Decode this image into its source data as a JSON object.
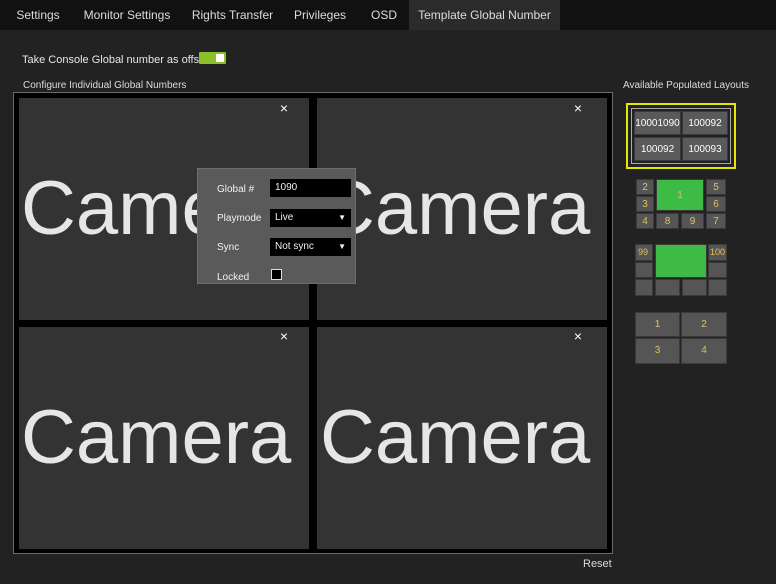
{
  "tabs": [
    {
      "label": "Settings",
      "active": false
    },
    {
      "label": "Monitor Settings",
      "active": false
    },
    {
      "label": "Rights Transfer",
      "active": false
    },
    {
      "label": "Privileges",
      "active": false
    },
    {
      "label": "OSD",
      "active": false
    },
    {
      "label": "Template Global Number",
      "active": true
    }
  ],
  "offset": {
    "label": "Take Console Global number as offset",
    "enabled": true
  },
  "configure_label": "Configure Individual Global Numbers",
  "available_label": "Available Populated Layouts",
  "panes": [
    {
      "text": "Camera",
      "close": "×"
    },
    {
      "text": "Camera",
      "close": "×"
    },
    {
      "text": "Camera",
      "close": "×"
    },
    {
      "text": "Camera",
      "close": "×"
    }
  ],
  "popup": {
    "global_label": "Global #",
    "global_value": "1090",
    "playmode_label": "Playmode",
    "playmode_value": "Live",
    "sync_label": "Sync",
    "sync_value": "Not sync",
    "locked_label": "Locked",
    "locked": false
  },
  "layouts": {
    "layout1": [
      "10001090",
      "100092",
      "100092",
      "100093"
    ],
    "layout2": [
      "2",
      "1",
      "5",
      "3",
      "6",
      "4",
      "8",
      "9",
      "7"
    ],
    "layout3": [
      "99",
      "100"
    ],
    "layout4": [
      "1",
      "2",
      "3",
      "4"
    ]
  },
  "colors": {
    "accent": "#8cbf2a",
    "selected_border": "#e6e600",
    "green_cell": "#3dbb45",
    "cell_number": "#e0c060"
  },
  "reset_label": "Reset"
}
